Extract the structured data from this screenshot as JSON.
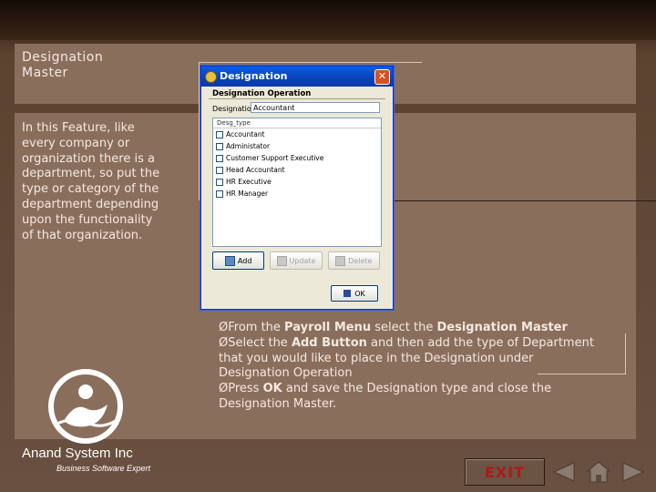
{
  "slide": {
    "title": "Designation Master",
    "description": "In this Feature, like every company or organization there is a department, so put the type or category of the department depending upon the functionality of that organization."
  },
  "dialog": {
    "title": "Designation",
    "close_label": "✕",
    "group_title": "Designation Operation",
    "designation_label": "Designation",
    "designation_value": "Accountant",
    "list_header": "Desg_type",
    "items": [
      "Accountant",
      "Administator",
      "Customer Support Executive",
      "Head Accountant",
      "HR Executive",
      "HR Manager"
    ],
    "buttons": {
      "add": "Add",
      "update": "Update",
      "delete": "Delete",
      "ok": "OK"
    }
  },
  "instructions": {
    "line1_a": "ØFrom the ",
    "line1_b": "Payroll Menu",
    "line1_c": " select the ",
    "line1_d": "Designation Master",
    "line2_a": "ØSelect the ",
    "line2_b": "Add  Button",
    "line2_c": " and then add the type of Department that you would like to place in the Designation under Designation Operation",
    "line3_a": "ØPress ",
    "line3_b": "OK",
    "line3_c": " and save the Designation type and close the Designation Master."
  },
  "brand": {
    "name": "Anand System Inc",
    "tagline": "Business Software Expert"
  },
  "nav": {
    "exit_label": "EXIT"
  },
  "icons": {
    "prev": "prev-arrow-icon",
    "home": "home-icon",
    "next": "next-arrow-icon"
  },
  "colors": {
    "panel": "#8a6e5c",
    "exit_text": "#b01818",
    "titlebar": "#0842b8"
  }
}
